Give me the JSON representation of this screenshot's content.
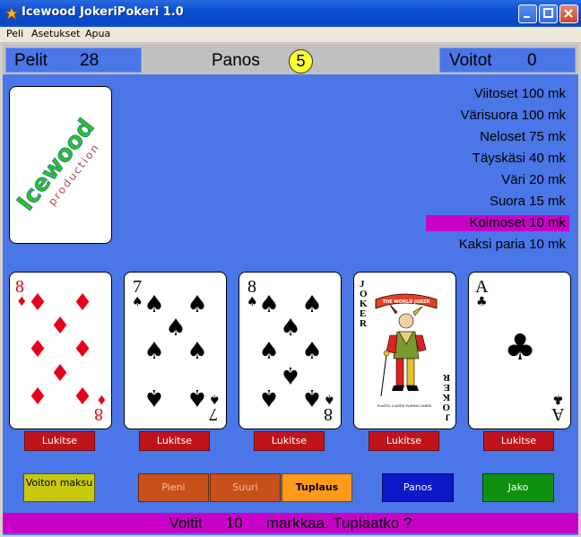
{
  "window": {
    "title": "Icewood JokeriPokeri 1.0"
  },
  "menu": [
    "Peli",
    "Asetukset",
    "Apua"
  ],
  "stats": {
    "games_label": "Pelit",
    "games_value": "28",
    "bet_label": "Panos",
    "bet_value": "5",
    "wins_label": "Voitot",
    "wins_value": "0"
  },
  "logo": {
    "brand": "Icewood",
    "sub": "production"
  },
  "paytable": [
    {
      "label": "Viitoset 100 mk",
      "highlight": false
    },
    {
      "label": "Värisuora 100 mk",
      "highlight": false
    },
    {
      "label": "Neloset 75 mk",
      "highlight": false
    },
    {
      "label": "Täyskäsi 40 mk",
      "highlight": false
    },
    {
      "label": "Väri 20 mk",
      "highlight": false
    },
    {
      "label": "Suora 15 mk",
      "highlight": false
    },
    {
      "label": "Kolmoset 10 mk",
      "highlight": true
    },
    {
      "label": "Kaksi paria 10 mk",
      "highlight": false
    }
  ],
  "cards": [
    {
      "rank": "8",
      "suit": "♦",
      "color": "#e8001c"
    },
    {
      "rank": "7",
      "suit": "♠",
      "color": "#000000"
    },
    {
      "rank": "8",
      "suit": "♠",
      "color": "#000000"
    },
    {
      "rank": "JOKER",
      "suit": "",
      "color": "#000000",
      "joker_banner": "THE WORLD JOKER",
      "joker_footer": "PLASTIC COATED PLAYING CARDS"
    },
    {
      "rank": "A",
      "suit": "♣",
      "color": "#000000"
    }
  ],
  "hold_label": "Lukitse",
  "buttons": {
    "payout": "Voiton maksu",
    "low": "Pieni",
    "high": "Suuri",
    "double": "Tuplaus",
    "bet": "Panos",
    "deal": "Jako"
  },
  "status": {
    "won_label": "Voitit",
    "amount": "10",
    "message": "markkaa. Tuplaatko ?"
  },
  "colors": {
    "table": "#4a76e8",
    "highlight": "#c800c8",
    "hold": "#c0141c",
    "payout": "#c8c810",
    "low_high": "#c8501a",
    "double": "#ff9a1a",
    "bet": "#0a18c8",
    "deal": "#109010"
  }
}
